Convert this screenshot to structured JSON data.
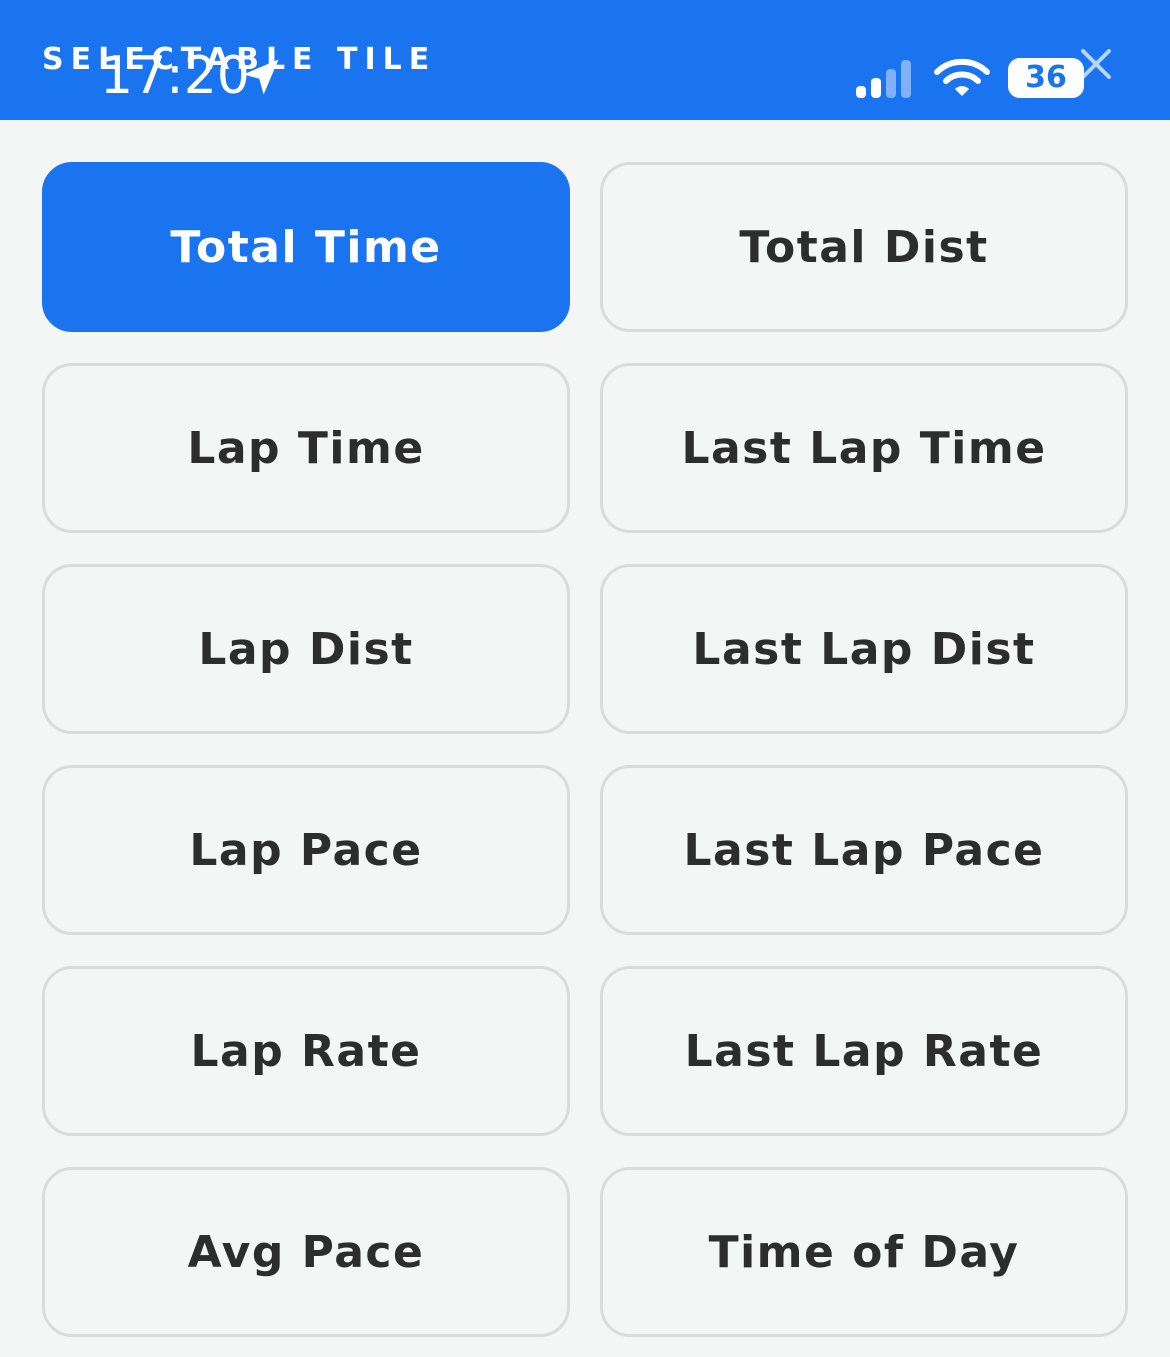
{
  "header": {
    "title": "SELECTABLE TILE"
  },
  "status_bar": {
    "time": "17:20",
    "battery_level": "36",
    "battery_fraction": 0.36
  },
  "colors": {
    "accent": "#1a74f0",
    "background": "#f4f6f5",
    "tile_border": "#d9dcdb",
    "tile_text": "#2d2d2d"
  },
  "tiles": [
    {
      "label": "Total Time",
      "selected": true
    },
    {
      "label": "Total Dist",
      "selected": false
    },
    {
      "label": "Lap Time",
      "selected": false
    },
    {
      "label": "Last Lap Time",
      "selected": false
    },
    {
      "label": "Lap Dist",
      "selected": false
    },
    {
      "label": "Last Lap Dist",
      "selected": false
    },
    {
      "label": "Lap Pace",
      "selected": false
    },
    {
      "label": "Last Lap Pace",
      "selected": false
    },
    {
      "label": "Lap Rate",
      "selected": false
    },
    {
      "label": "Last Lap Rate",
      "selected": false
    },
    {
      "label": "Avg Pace",
      "selected": false
    },
    {
      "label": "Time of Day",
      "selected": false
    }
  ]
}
